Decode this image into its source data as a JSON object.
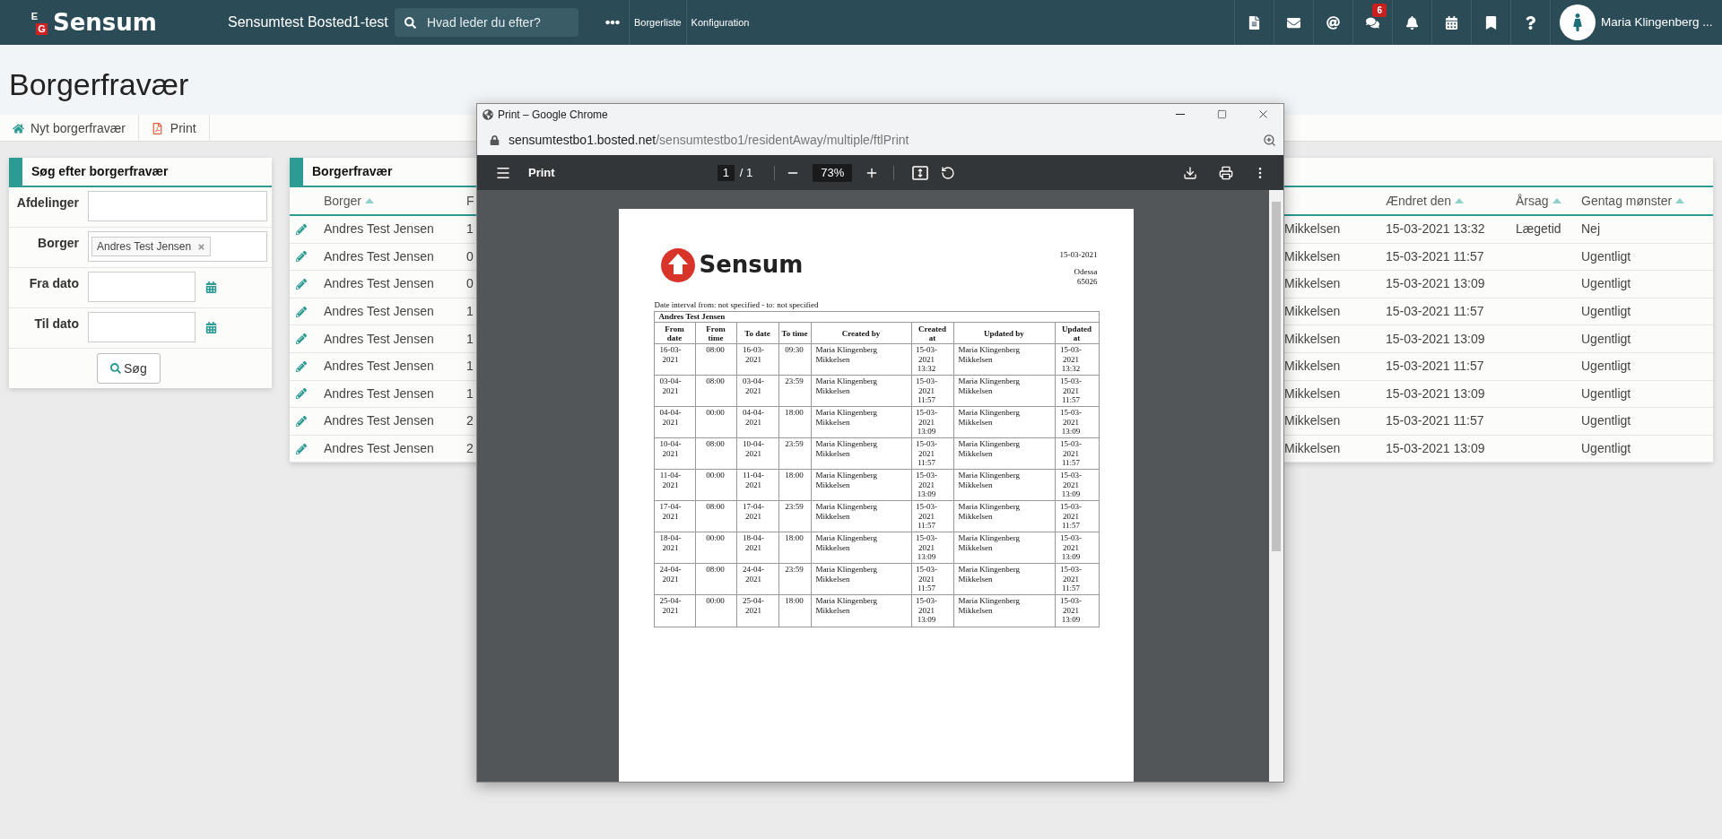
{
  "topbar": {
    "logo_letters": [
      "E",
      "G"
    ],
    "logo": "Sensum",
    "site": "Sensumtest Bosted1-test",
    "search": {
      "placeholder": "Hvad leder du efter?"
    },
    "nav": [
      "Borgerliste",
      "Konfiguration"
    ],
    "message_badge": "6",
    "user": "Maria Klingenberg ..."
  },
  "page_title": "Borgerfravær",
  "toolbar": [
    {
      "kind": "home",
      "label": "Nyt borgerfravær"
    },
    {
      "kind": "pdf",
      "label": "Print"
    }
  ],
  "search_panel": {
    "title": "Søg efter borgerfravær",
    "fields": [
      {
        "kind": "text",
        "label": "Afdelinger"
      },
      {
        "kind": "tags",
        "label": "Borger",
        "tags": [
          "Andres Test Jensen"
        ]
      },
      {
        "kind": "date",
        "label": "Fra dato"
      },
      {
        "kind": "date",
        "label": "Til dato"
      }
    ],
    "button": "Søg"
  },
  "table": {
    "title": "Borgerfravær",
    "columns": [
      {
        "label": "Borger",
        "sort_arrow": true
      },
      {
        "label": "F"
      },
      null,
      {
        "label": "Ændret den",
        "sort_arrow": true
      },
      {
        "label": "Årsag",
        "sort_arrow": true
      },
      {
        "label": "Gentag mønster",
        "sort_arrow": true
      }
    ],
    "rows": [
      {
        "borger": "Andres Test Jensen",
        "column_2": "1",
        "column_3": "Mikkelsen",
        "aendret_den": "15-03-2021 13:32",
        "aarsag": "Lægetid",
        "gentag_moenster": "Nej"
      },
      {
        "borger": "Andres Test Jensen",
        "column_2": "0",
        "column_3": "Mikkelsen",
        "aendret_den": "15-03-2021 11:57",
        "gentag_moenster": "Ugentligt"
      },
      {
        "borger": "Andres Test Jensen",
        "column_2": "0",
        "column_3": "Mikkelsen",
        "aendret_den": "15-03-2021 13:09",
        "gentag_moenster": "Ugentligt"
      },
      {
        "borger": "Andres Test Jensen",
        "column_2": "1",
        "column_3": "Mikkelsen",
        "aendret_den": "15-03-2021 11:57",
        "gentag_moenster": "Ugentligt"
      },
      {
        "borger": "Andres Test Jensen",
        "column_2": "1",
        "column_3": "Mikkelsen",
        "aendret_den": "15-03-2021 13:09",
        "gentag_moenster": "Ugentligt"
      },
      {
        "borger": "Andres Test Jensen",
        "column_2": "1",
        "column_3": "Mikkelsen",
        "aendret_den": "15-03-2021 11:57",
        "gentag_moenster": "Ugentligt"
      },
      {
        "borger": "Andres Test Jensen",
        "column_2": "1",
        "column_3": "Mikkelsen",
        "aendret_den": "15-03-2021 13:09",
        "gentag_moenster": "Ugentligt"
      },
      {
        "borger": "Andres Test Jensen",
        "column_2": "2",
        "column_3": "Mikkelsen",
        "aendret_den": "15-03-2021 11:57",
        "gentag_moenster": "Ugentligt"
      },
      {
        "borger": "Andres Test Jensen",
        "column_2": "2",
        "column_3": "Mikkelsen",
        "aendret_den": "15-03-2021 13:09",
        "gentag_moenster": "Ugentligt"
      }
    ]
  },
  "print_window": {
    "title": "Print – Google Chrome",
    "url_domain": "sensumtestbo1.bosted.net",
    "url_path": "/sensumtestbo1/residentAway/multiple/ftlPrint",
    "viewer": {
      "title": "Print",
      "page": "1",
      "page_total": "/ 1",
      "zoom": "73%"
    },
    "document": {
      "logo": "Sensum",
      "date": "15-03-2021",
      "address": [
        "Odessa",
        "65026"
      ],
      "interval": "Date interval from: not specified - to: not specified",
      "group": "Andres Test Jensen",
      "columns": [
        "From date",
        "From time",
        "To date",
        "To time",
        "Created by",
        "Created at",
        "Updated by",
        "Updated at"
      ],
      "rows": [
        [
          "16-03-2021",
          "08:00",
          "16-03-2021",
          "09:30",
          "Maria Klingenberg Mikkelsen",
          "15-03-2021 13:32",
          "Maria Klingenberg Mikkelsen",
          "15-03-2021 13:32"
        ],
        [
          "03-04-2021",
          "08:00",
          "03-04-2021",
          "23:59",
          "Maria Klingenberg Mikkelsen",
          "15-03-2021 11:57",
          "Maria Klingenberg Mikkelsen",
          "15-03-2021 11:57"
        ],
        [
          "04-04-2021",
          "00:00",
          "04-04-2021",
          "18:00",
          "Maria Klingenberg Mikkelsen",
          "15-03-2021 13:09",
          "Maria Klingenberg Mikkelsen",
          "15-03-2021 13:09"
        ],
        [
          "10-04-2021",
          "08:00",
          "10-04-2021",
          "23:59",
          "Maria Klingenberg Mikkelsen",
          "15-03-2021 11:57",
          "Maria Klingenberg Mikkelsen",
          "15-03-2021 11:57"
        ],
        [
          "11-04-2021",
          "00:00",
          "11-04-2021",
          "18:00",
          "Maria Klingenberg Mikkelsen",
          "15-03-2021 13:09",
          "Maria Klingenberg Mikkelsen",
          "15-03-2021 13:09"
        ],
        [
          "17-04-2021",
          "08:00",
          "17-04-2021",
          "23:59",
          "Maria Klingenberg Mikkelsen",
          "15-03-2021 11:57",
          "Maria Klingenberg Mikkelsen",
          "15-03-2021 11:57"
        ],
        [
          "18-04-2021",
          "00:00",
          "18-04-2021",
          "18:00",
          "Maria Klingenberg Mikkelsen",
          "15-03-2021 13:09",
          "Maria Klingenberg Mikkelsen",
          "15-03-2021 13:09"
        ],
        [
          "24-04-2021",
          "08:00",
          "24-04-2021",
          "23:59",
          "Maria Klingenberg Mikkelsen",
          "15-03-2021 11:57",
          "Maria Klingenberg Mikkelsen",
          "15-03-2021 11:57"
        ],
        [
          "25-04-2021",
          "00:00",
          "25-04-2021",
          "18:00",
          "Maria Klingenberg Mikkelsen",
          "15-03-2021 13:09",
          "Maria Klingenberg Mikkelsen",
          "15-03-2021 13:09"
        ]
      ]
    }
  }
}
